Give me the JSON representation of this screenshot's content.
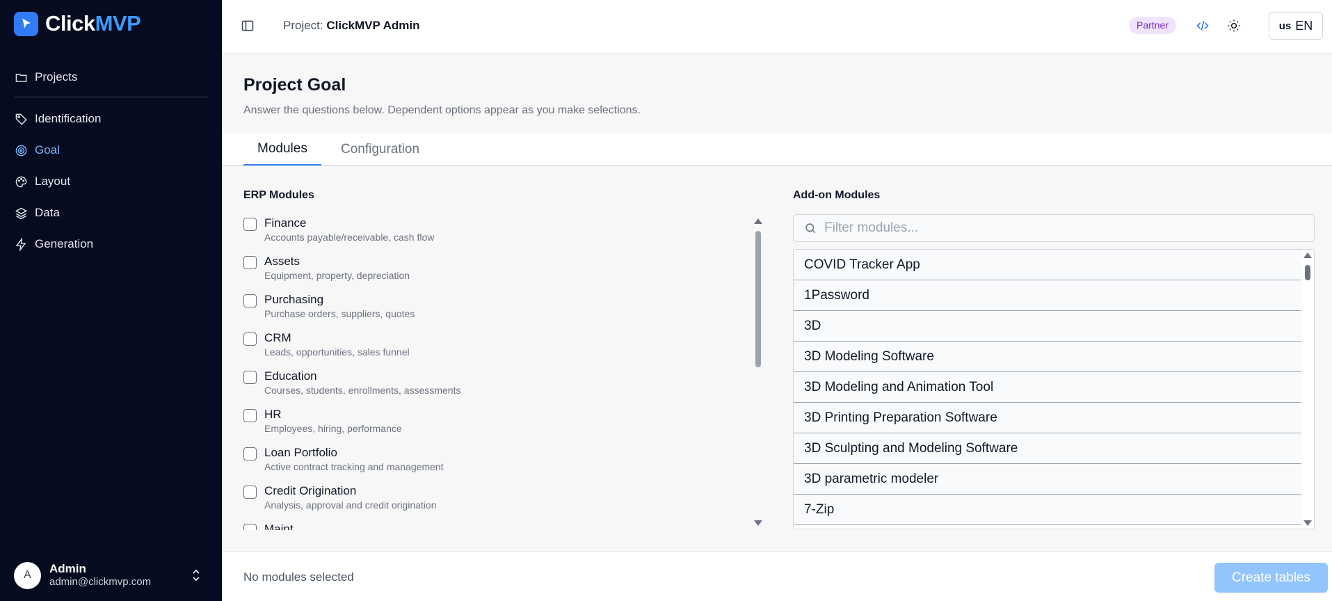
{
  "brand": {
    "name_part1": "Click",
    "name_part2": "MVP"
  },
  "sidebar": {
    "projects_label": "Projects",
    "items": [
      {
        "label": "Identification",
        "icon": "tag-icon"
      },
      {
        "label": "Goal",
        "icon": "target-icon",
        "active": true
      },
      {
        "label": "Layout",
        "icon": "palette-icon"
      },
      {
        "label": "Data",
        "icon": "layers-icon"
      },
      {
        "label": "Generation",
        "icon": "zap-icon"
      }
    ],
    "user": {
      "initial": "A",
      "name": "Admin",
      "email": "admin@clickmvp.com"
    }
  },
  "header": {
    "project_label": "Project:",
    "project_name": "ClickMVP Admin",
    "badge": "Partner",
    "lang_flag": "us",
    "lang": "EN"
  },
  "page": {
    "title": "Project Goal",
    "subtitle": "Answer the questions below. Dependent options appear as you make selections."
  },
  "tabs": [
    {
      "label": "Modules",
      "active": true
    },
    {
      "label": "Configuration",
      "active": false
    }
  ],
  "erp": {
    "title": "ERP Modules",
    "items": [
      {
        "name": "Finance",
        "desc": "Accounts payable/receivable, cash flow"
      },
      {
        "name": "Assets",
        "desc": "Equipment, property, depreciation"
      },
      {
        "name": "Purchasing",
        "desc": "Purchase orders, suppliers, quotes"
      },
      {
        "name": "CRM",
        "desc": "Leads, opportunities, sales funnel"
      },
      {
        "name": "Education",
        "desc": "Courses, students, enrollments, assessments"
      },
      {
        "name": "HR",
        "desc": "Employees, hiring, performance"
      },
      {
        "name": "Loan Portfolio",
        "desc": "Active contract tracking and management"
      },
      {
        "name": "Credit Origination",
        "desc": "Analysis, approval and credit origination"
      },
      {
        "name": "Maint",
        "desc": ""
      }
    ]
  },
  "addons": {
    "title": "Add-on Modules",
    "filter_placeholder": "Filter modules...",
    "items": [
      "COVID Tracker App",
      "1Password",
      "3D",
      "3D Modeling Software",
      "3D Modeling and Animation Tool",
      "3D Printing Preparation Software",
      "3D Sculpting and Modeling Software",
      "3D parametric modeler",
      "7-Zip"
    ]
  },
  "footer": {
    "status": "No modules selected",
    "create_label": "Create tables"
  },
  "colors": {
    "sidebar_bg": "#060b1f",
    "accent": "#2f7cf6",
    "active_nav": "#7db7ff",
    "badge_bg": "#efe4fb",
    "badge_text": "#7e22ce",
    "create_btn": "#93c5fd"
  }
}
